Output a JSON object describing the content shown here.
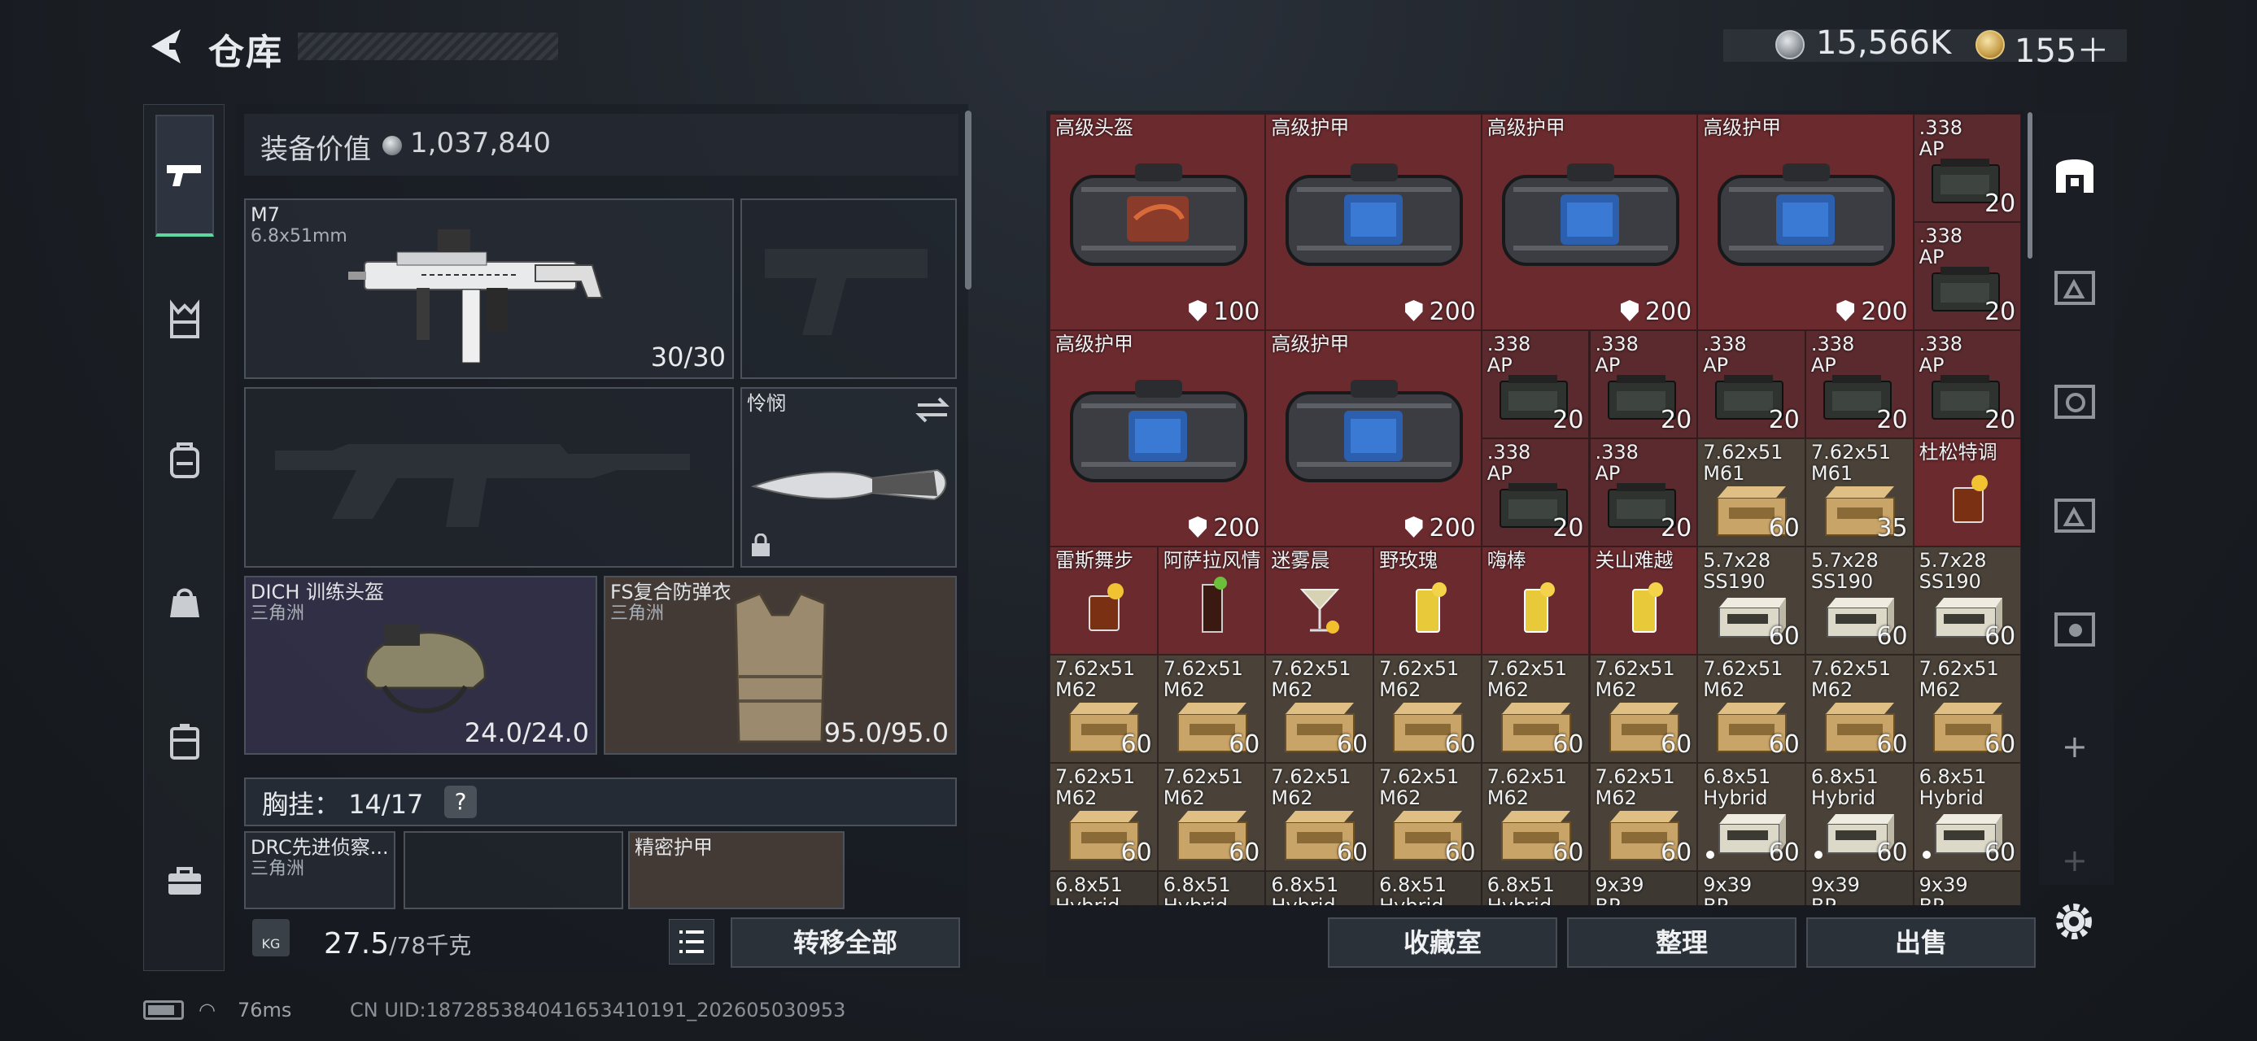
{
  "header": {
    "title": "仓库",
    "money": "15,566K",
    "tokens": "155＋"
  },
  "sidebar": {
    "tabs": [
      {
        "icon": "pistol-icon",
        "active": true
      },
      {
        "icon": "vest-icon"
      },
      {
        "icon": "backpack-icon"
      },
      {
        "icon": "bag-icon"
      },
      {
        "icon": "case-icon"
      },
      {
        "icon": "toolbox-icon"
      }
    ]
  },
  "loadout": {
    "value_label": "装备价值",
    "value": "1,037,840",
    "primary": {
      "name": "M7",
      "caliber": "6.8x51mm",
      "ammo": "30/30"
    },
    "melee": {
      "name": "怜悯"
    },
    "helmet": {
      "name": "DICH 训练头盔",
      "origin": "三角洲",
      "durability": "24.0/24.0"
    },
    "armor": {
      "name": "FS复合防弹衣",
      "origin": "三角洲",
      "durability": "95.0/95.0"
    },
    "chest_rig_label": "胸挂：",
    "chest_rig_count": "14/17",
    "help": "?",
    "rig_slot_1_name": "DRC先进侦察...",
    "rig_slot_1_origin": "三角洲",
    "rig_slot_3_name": "精密护甲",
    "weight": "27.5",
    "weight_max": "/78千克",
    "weight_icon": "KG",
    "move_all": "转移全部"
  },
  "stash": {
    "tiles": [
      {
        "c": 0,
        "r": 0,
        "w": 2,
        "h": 2,
        "lines": [
          "高级头盔"
        ],
        "count": "100",
        "shield": true,
        "art": "bag-red"
      },
      {
        "c": 2,
        "r": 0,
        "w": 2,
        "h": 2,
        "lines": [
          "高级护甲"
        ],
        "count": "200",
        "shield": true,
        "art": "bag-blue"
      },
      {
        "c": 4,
        "r": 0,
        "w": 2,
        "h": 2,
        "lines": [
          "高级护甲"
        ],
        "count": "200",
        "shield": true,
        "art": "bag-blue"
      },
      {
        "c": 6,
        "r": 0,
        "w": 2,
        "h": 2,
        "lines": [
          "高级护甲"
        ],
        "count": "200",
        "shield": true,
        "art": "bag-blue"
      },
      {
        "c": 8,
        "r": 0,
        "w": 1,
        "h": 1,
        "lines": [
          ".338",
          "AP"
        ],
        "count": "20",
        "art": "ammobox"
      },
      {
        "c": 8,
        "r": 1,
        "w": 1,
        "h": 1,
        "lines": [
          ".338",
          "AP"
        ],
        "count": "20",
        "art": "ammobox"
      },
      {
        "c": 0,
        "r": 2,
        "w": 2,
        "h": 2,
        "lines": [
          "高级护甲"
        ],
        "count": "200",
        "shield": true,
        "art": "bag-blue"
      },
      {
        "c": 2,
        "r": 2,
        "w": 2,
        "h": 2,
        "lines": [
          "高级护甲"
        ],
        "count": "200",
        "shield": true,
        "art": "bag-blue"
      },
      {
        "c": 4,
        "r": 2,
        "w": 1,
        "h": 1,
        "lines": [
          ".338",
          "AP"
        ],
        "count": "20",
        "art": "ammobox"
      },
      {
        "c": 5,
        "r": 2,
        "w": 1,
        "h": 1,
        "lines": [
          ".338",
          "AP"
        ],
        "count": "20",
        "art": "ammobox"
      },
      {
        "c": 6,
        "r": 2,
        "w": 1,
        "h": 1,
        "lines": [
          ".338",
          "AP"
        ],
        "count": "20",
        "art": "ammobox"
      },
      {
        "c": 7,
        "r": 2,
        "w": 1,
        "h": 1,
        "lines": [
          ".338",
          "AP"
        ],
        "count": "20",
        "art": "ammobox"
      },
      {
        "c": 8,
        "r": 2,
        "w": 1,
        "h": 1,
        "lines": [
          ".338",
          "AP"
        ],
        "count": "20",
        "art": "ammobox"
      },
      {
        "c": 4,
        "r": 3,
        "w": 1,
        "h": 1,
        "lines": [
          ".338",
          "AP"
        ],
        "count": "20",
        "art": "ammobox"
      },
      {
        "c": 5,
        "r": 3,
        "w": 1,
        "h": 1,
        "lines": [
          ".338",
          "AP"
        ],
        "count": "20",
        "art": "ammobox"
      },
      {
        "c": 6,
        "r": 3,
        "w": 1,
        "h": 1,
        "lines": [
          "7.62x51",
          "M61"
        ],
        "count": "60",
        "art": "crate"
      },
      {
        "c": 7,
        "r": 3,
        "w": 1,
        "h": 1,
        "lines": [
          "7.62x51",
          "M61"
        ],
        "count": "35",
        "art": "crate"
      },
      {
        "c": 8,
        "r": 3,
        "w": 1,
        "h": 1,
        "lines": [
          "杜松特调"
        ],
        "count": "",
        "art": "cocktail-amber"
      },
      {
        "c": 0,
        "r": 4,
        "w": 1,
        "h": 1,
        "lines": [
          "雷斯舞步"
        ],
        "count": "",
        "art": "cocktail-amber"
      },
      {
        "c": 1,
        "r": 4,
        "w": 1,
        "h": 1,
        "lines": [
          "阿萨拉风情"
        ],
        "count": "",
        "art": "cocktail-dark"
      },
      {
        "c": 2,
        "r": 4,
        "w": 1,
        "h": 1,
        "lines": [
          "迷雾晨"
        ],
        "count": "",
        "art": "cocktail-clear"
      },
      {
        "c": 3,
        "r": 4,
        "w": 1,
        "h": 1,
        "lines": [
          "野玫瑰"
        ],
        "count": "",
        "art": "cocktail-yellow"
      },
      {
        "c": 4,
        "r": 4,
        "w": 1,
        "h": 1,
        "lines": [
          "嗨棒"
        ],
        "count": "",
        "art": "cocktail-yellow"
      },
      {
        "c": 5,
        "r": 4,
        "w": 1,
        "h": 1,
        "lines": [
          "关山难越"
        ],
        "count": "",
        "art": "cocktail-yellow"
      },
      {
        "c": 6,
        "r": 4,
        "w": 1,
        "h": 1,
        "lines": [
          "5.7x28",
          "SS190"
        ],
        "count": "60",
        "art": "pack"
      },
      {
        "c": 7,
        "r": 4,
        "w": 1,
        "h": 1,
        "lines": [
          "5.7x28",
          "SS190"
        ],
        "count": "60",
        "art": "pack"
      },
      {
        "c": 8,
        "r": 4,
        "w": 1,
        "h": 1,
        "lines": [
          "5.7x28",
          "SS190"
        ],
        "count": "60",
        "art": "pack"
      },
      {
        "c": 0,
        "r": 5,
        "w": 1,
        "h": 1,
        "lines": [
          "7.62x51",
          "M62"
        ],
        "count": "60",
        "art": "crate"
      },
      {
        "c": 1,
        "r": 5,
        "w": 1,
        "h": 1,
        "lines": [
          "7.62x51",
          "M62"
        ],
        "count": "60",
        "art": "crate"
      },
      {
        "c": 2,
        "r": 5,
        "w": 1,
        "h": 1,
        "lines": [
          "7.62x51",
          "M62"
        ],
        "count": "60",
        "art": "crate"
      },
      {
        "c": 3,
        "r": 5,
        "w": 1,
        "h": 1,
        "lines": [
          "7.62x51",
          "M62"
        ],
        "count": "60",
        "art": "crate"
      },
      {
        "c": 4,
        "r": 5,
        "w": 1,
        "h": 1,
        "lines": [
          "7.62x51",
          "M62"
        ],
        "count": "60",
        "art": "crate"
      },
      {
        "c": 5,
        "r": 5,
        "w": 1,
        "h": 1,
        "lines": [
          "7.62x51",
          "M62"
        ],
        "count": "60",
        "art": "crate"
      },
      {
        "c": 6,
        "r": 5,
        "w": 1,
        "h": 1,
        "lines": [
          "7.62x51",
          "M62"
        ],
        "count": "60",
        "art": "crate"
      },
      {
        "c": 7,
        "r": 5,
        "w": 1,
        "h": 1,
        "lines": [
          "7.62x51",
          "M62"
        ],
        "count": "60",
        "art": "crate"
      },
      {
        "c": 8,
        "r": 5,
        "w": 1,
        "h": 1,
        "lines": [
          "7.62x51",
          "M62"
        ],
        "count": "60",
        "art": "crate"
      },
      {
        "c": 0,
        "r": 6,
        "w": 1,
        "h": 1,
        "lines": [
          "7.62x51",
          "M62"
        ],
        "count": "60",
        "art": "crate"
      },
      {
        "c": 1,
        "r": 6,
        "w": 1,
        "h": 1,
        "lines": [
          "7.62x51",
          "M62"
        ],
        "count": "60",
        "art": "crate"
      },
      {
        "c": 2,
        "r": 6,
        "w": 1,
        "h": 1,
        "lines": [
          "7.62x51",
          "M62"
        ],
        "count": "60",
        "art": "crate"
      },
      {
        "c": 3,
        "r": 6,
        "w": 1,
        "h": 1,
        "lines": [
          "7.62x51",
          "M62"
        ],
        "count": "60",
        "art": "crate"
      },
      {
        "c": 4,
        "r": 6,
        "w": 1,
        "h": 1,
        "lines": [
          "7.62x51",
          "M62"
        ],
        "count": "60",
        "art": "crate"
      },
      {
        "c": 5,
        "r": 6,
        "w": 1,
        "h": 1,
        "lines": [
          "7.62x51",
          "M62"
        ],
        "count": "60",
        "art": "crate"
      },
      {
        "c": 6,
        "r": 6,
        "w": 1,
        "h": 1,
        "lines": [
          "6.8x51",
          "Hybrid"
        ],
        "count": "60",
        "dot": true,
        "art": "pack"
      },
      {
        "c": 7,
        "r": 6,
        "w": 1,
        "h": 1,
        "lines": [
          "6.8x51",
          "Hybrid"
        ],
        "count": "60",
        "dot": true,
        "art": "pack"
      },
      {
        "c": 8,
        "r": 6,
        "w": 1,
        "h": 1,
        "lines": [
          "6.8x51",
          "Hybrid"
        ],
        "count": "60",
        "dot": true,
        "art": "pack"
      },
      {
        "c": 0,
        "r": 7,
        "w": 1,
        "h": 1,
        "lines": [
          "6.8x51",
          "Hybrid"
        ],
        "count": "",
        "art": "pack"
      },
      {
        "c": 1,
        "r": 7,
        "w": 1,
        "h": 1,
        "lines": [
          "6.8x51",
          "Hybrid"
        ],
        "count": "",
        "art": "pack"
      },
      {
        "c": 2,
        "r": 7,
        "w": 1,
        "h": 1,
        "lines": [
          "6.8x51",
          "Hybrid"
        ],
        "count": "",
        "art": "pack"
      },
      {
        "c": 3,
        "r": 7,
        "w": 1,
        "h": 1,
        "lines": [
          "6.8x51",
          "Hybrid"
        ],
        "count": "",
        "art": "pack"
      },
      {
        "c": 4,
        "r": 7,
        "w": 1,
        "h": 1,
        "lines": [
          "6.8x51",
          "Hybrid"
        ],
        "count": "",
        "art": "pack"
      },
      {
        "c": 5,
        "r": 7,
        "w": 1,
        "h": 1,
        "lines": [
          "9x39",
          "BP"
        ],
        "count": "",
        "art": "pack"
      },
      {
        "c": 6,
        "r": 7,
        "w": 1,
        "h": 1,
        "lines": [
          "9x39",
          "BP"
        ],
        "count": "",
        "art": "pack"
      },
      {
        "c": 7,
        "r": 7,
        "w": 1,
        "h": 1,
        "lines": [
          "9x39",
          "BP"
        ],
        "count": "",
        "art": "pack"
      },
      {
        "c": 8,
        "r": 7,
        "w": 1,
        "h": 1,
        "lines": [
          "9x39",
          "BP"
        ],
        "count": "",
        "art": "pack"
      }
    ],
    "buttons": {
      "collection": "收藏室",
      "sort": "整理",
      "sell": "出售"
    }
  },
  "rail": {
    "icons": [
      "main-stash-icon",
      "stash-2-icon",
      "stash-3-icon",
      "stash-4-icon",
      "stash-5-icon"
    ],
    "plus": "+",
    "plus_dim": "+"
  },
  "status": {
    "ping": "76ms",
    "uid": "CN UID:187285384041653410191_202605030953"
  }
}
